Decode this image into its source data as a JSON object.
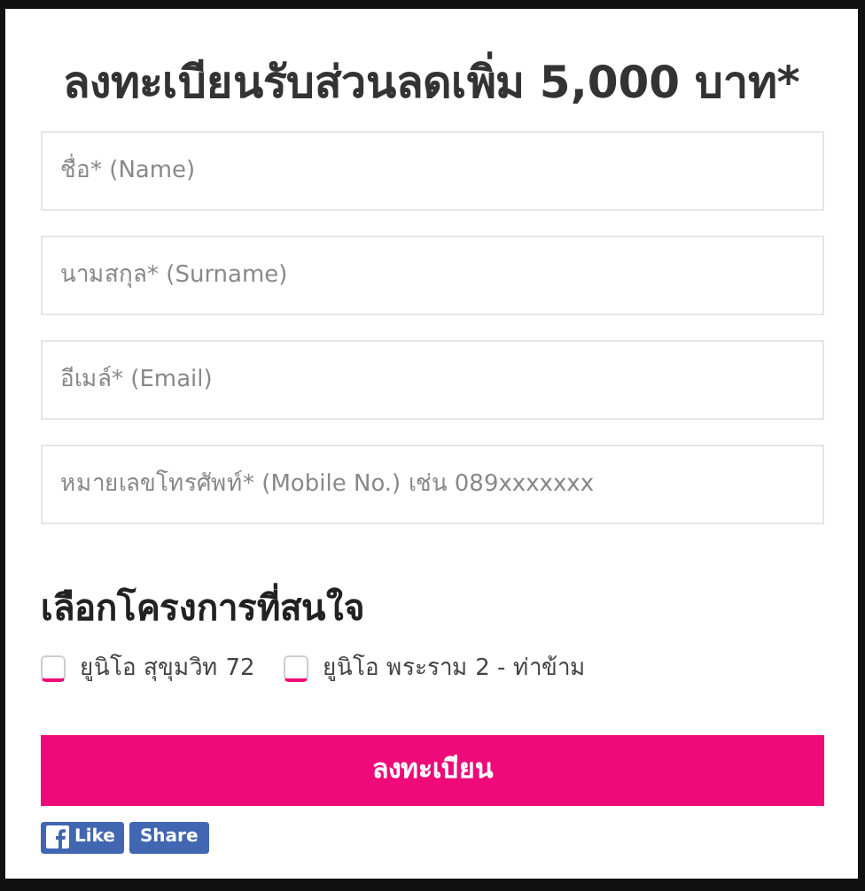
{
  "title": "ลงทะเบียนรับส่วนลดเพิ่ม 5,000 บาท*",
  "fields": [
    {
      "placeholder": "ชื่อ* (Name)"
    },
    {
      "placeholder": "นามสกุล* (Surname)"
    },
    {
      "placeholder": "อีเมล์* (Email)"
    },
    {
      "placeholder": "หมายเลขโทรศัพท์* (Mobile No.) เช่น 089xxxxxxx"
    }
  ],
  "projects": {
    "heading": "เลือกโครงการที่สนใจ",
    "options": [
      {
        "label": "ยูนิโอ สุขุมวิท 72",
        "checked": false
      },
      {
        "label": "ยูนิโอ พระราม 2 - ท่าข้าม",
        "checked": false
      }
    ]
  },
  "submit": "ลงทะเบียน",
  "social": {
    "like": "Like",
    "share": "Share"
  }
}
